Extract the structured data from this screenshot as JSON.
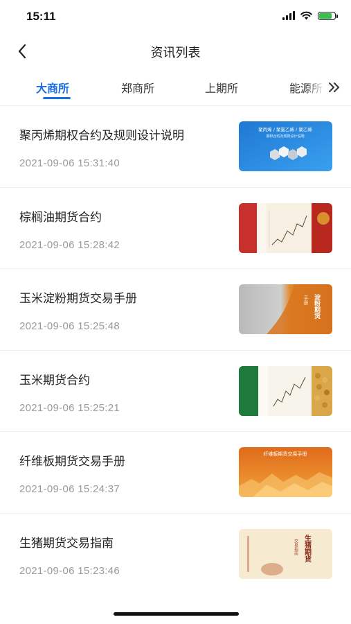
{
  "status_bar": {
    "time": "15:11",
    "battery_level": 0.8
  },
  "nav": {
    "title": "资讯列表"
  },
  "tabs": [
    {
      "label": "大商所",
      "active": true
    },
    {
      "label": "郑商所",
      "active": false
    },
    {
      "label": "上期所",
      "active": false
    },
    {
      "label": "能源所",
      "active": false
    }
  ],
  "news": [
    {
      "title": "聚丙烯期权合约及规则设计说明",
      "time": "2021-09-06 15:31:40",
      "thumb_text": "聚丙烯 / 聚氯乙烯 / 聚乙烯",
      "thumb_subtext": "期权合约及规则设计说明"
    },
    {
      "title": "棕榈油期货合约",
      "time": "2021-09-06 15:28:42"
    },
    {
      "title": "玉米淀粉期货交易手册",
      "time": "2021-09-06 15:25:48",
      "thumb_text": "淀粉期货",
      "thumb_subtext": "手册"
    },
    {
      "title": "玉米期货合约",
      "time": "2021-09-06 15:25:21"
    },
    {
      "title": "纤维板期货交易手册",
      "time": "2021-09-06 15:24:37",
      "thumb_text": "纤维板期货交易手册"
    },
    {
      "title": "生猪期货交易指南",
      "time": "2021-09-06 15:23:46",
      "thumb_text": "生猪期货",
      "thumb_subtext": "交易指南"
    }
  ]
}
